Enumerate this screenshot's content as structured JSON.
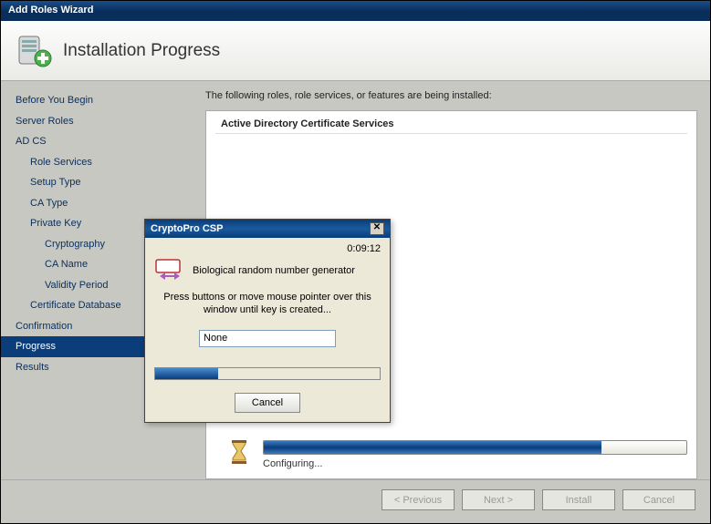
{
  "window": {
    "title": "Add Roles Wizard"
  },
  "header": {
    "title": "Installation Progress"
  },
  "sidebar": {
    "items": [
      {
        "label": "Before You Begin",
        "level": 1
      },
      {
        "label": "Server Roles",
        "level": 1
      },
      {
        "label": "AD CS",
        "level": 1
      },
      {
        "label": "Role Services",
        "level": 2
      },
      {
        "label": "Setup Type",
        "level": 2
      },
      {
        "label": "CA Type",
        "level": 2
      },
      {
        "label": "Private Key",
        "level": 2
      },
      {
        "label": "Cryptography",
        "level": 3
      },
      {
        "label": "CA Name",
        "level": 3
      },
      {
        "label": "Validity Period",
        "level": 3
      },
      {
        "label": "Certificate Database",
        "level": 2
      },
      {
        "label": "Confirmation",
        "level": 1
      },
      {
        "label": "Progress",
        "level": 1,
        "selected": true
      },
      {
        "label": "Results",
        "level": 1
      }
    ]
  },
  "main": {
    "intro": "The following roles, role services, or features are being installed:",
    "install_head": "Active Directory Certificate Services",
    "progress_label": "Configuring...",
    "progress_percent": 80
  },
  "footer": {
    "previous": "< Previous",
    "next": "Next >",
    "install": "Install",
    "cancel": "Cancel"
  },
  "dialog": {
    "title": "CryptoPro CSP",
    "timer": "0:09:12",
    "subtitle": "Biological random number generator",
    "instruction": "Press buttons or move mouse pointer over this window until key is created...",
    "input_value": "None",
    "progress_percent": 28,
    "cancel": "Cancel"
  }
}
